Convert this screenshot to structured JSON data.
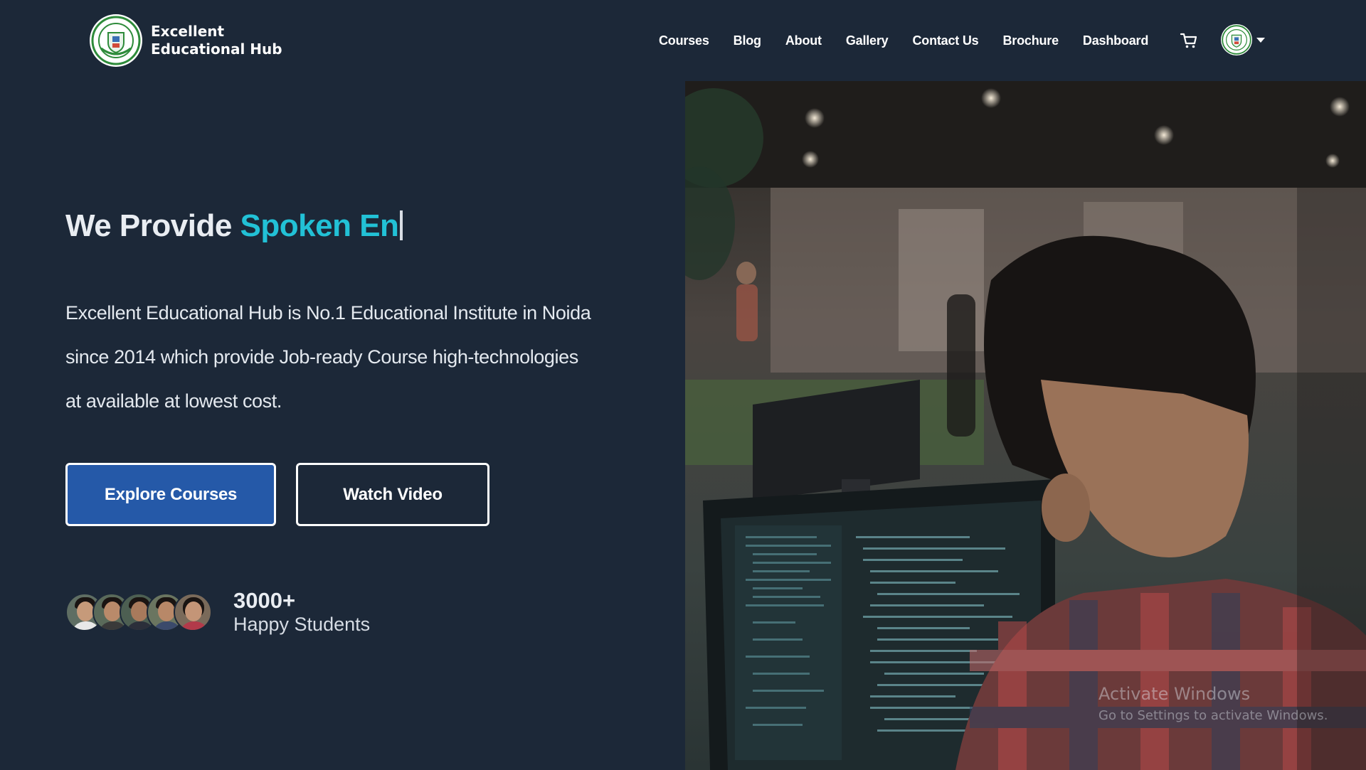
{
  "brand": {
    "name_line1": "Excellent",
    "name_line2": "Educational Hub"
  },
  "nav": {
    "links": [
      "Courses",
      "Blog",
      "About",
      "Gallery",
      "Contact Us",
      "Brochure",
      "Dashboard"
    ],
    "cart_icon": "cart-icon",
    "profile_icon": "avatar"
  },
  "hero": {
    "title_prefix": "We Provide ",
    "title_accent": "Spoken En",
    "accent_color": "#22c1d6",
    "description": "Excellent Educational Hub is No.1 Educational Institute in Noida since 2014 which provide Job-ready Course high-technologies at available at lowest cost.",
    "primary_button": "Explore Courses",
    "secondary_button": "Watch Video",
    "student_count": "3000+",
    "student_label": "Happy Students"
  },
  "watermark": {
    "title": "Activate Windows",
    "subtitle": "Go to Settings to activate Windows."
  },
  "colors": {
    "background": "#1c2838",
    "primary_button": "#2559a8"
  }
}
